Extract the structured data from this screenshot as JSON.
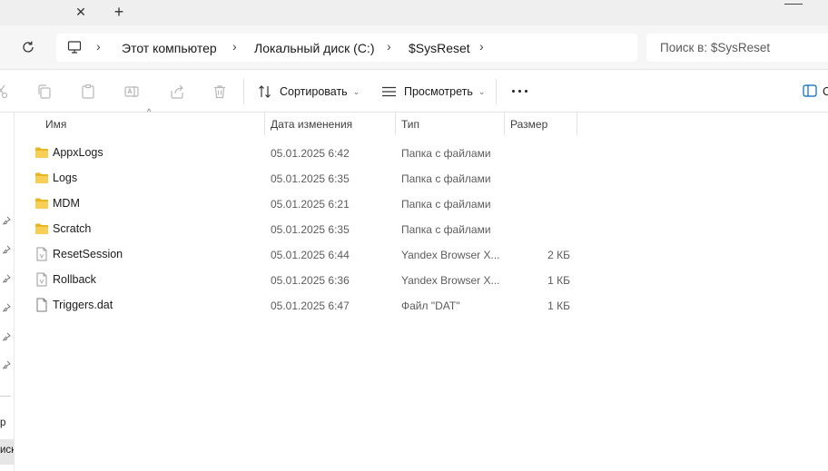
{
  "tabs": {
    "close_glyph": "✕",
    "new_glyph": "+"
  },
  "address": {
    "crumbs": [
      "Этот компьютер",
      "Локальный диск (C:)",
      "$SysReset"
    ],
    "search_placeholder": "Поиск в: $SysReset"
  },
  "toolbar": {
    "sort_label": "Сортировать",
    "view_label": "Просмотреть",
    "details_label": "С"
  },
  "navpane": {
    "partial_items": [
      "р",
      "иск"
    ]
  },
  "columns": {
    "name": "Имя",
    "date": "Дата изменения",
    "type": "Тип",
    "size": "Размер"
  },
  "files": [
    {
      "name": "AppxLogs",
      "date": "05.01.2025 6:42",
      "type": "Папка с файлами",
      "size": "",
      "icon": "folder-icon"
    },
    {
      "name": "Logs",
      "date": "05.01.2025 6:35",
      "type": "Папка с файлами",
      "size": "",
      "icon": "folder-icon"
    },
    {
      "name": "MDM",
      "date": "05.01.2025 6:21",
      "type": "Папка с файлами",
      "size": "",
      "icon": "folder-icon"
    },
    {
      "name": "Scratch",
      "date": "05.01.2025 6:35",
      "type": "Папка с файлами",
      "size": "",
      "icon": "folder-icon"
    },
    {
      "name": "ResetSession",
      "date": "05.01.2025 6:44",
      "type": "Yandex Browser X...",
      "size": "2 КБ",
      "icon": "xml-file-icon"
    },
    {
      "name": "Rollback",
      "date": "05.01.2025 6:36",
      "type": "Yandex Browser X...",
      "size": "1 КБ",
      "icon": "xml-file-icon"
    },
    {
      "name": "Triggers.dat",
      "date": "05.01.2025 6:47",
      "type": "Файл \"DAT\"",
      "size": "1 КБ",
      "icon": "file-icon"
    }
  ],
  "colors": {
    "folder": "#f4c430",
    "accent": "#0067c0"
  }
}
